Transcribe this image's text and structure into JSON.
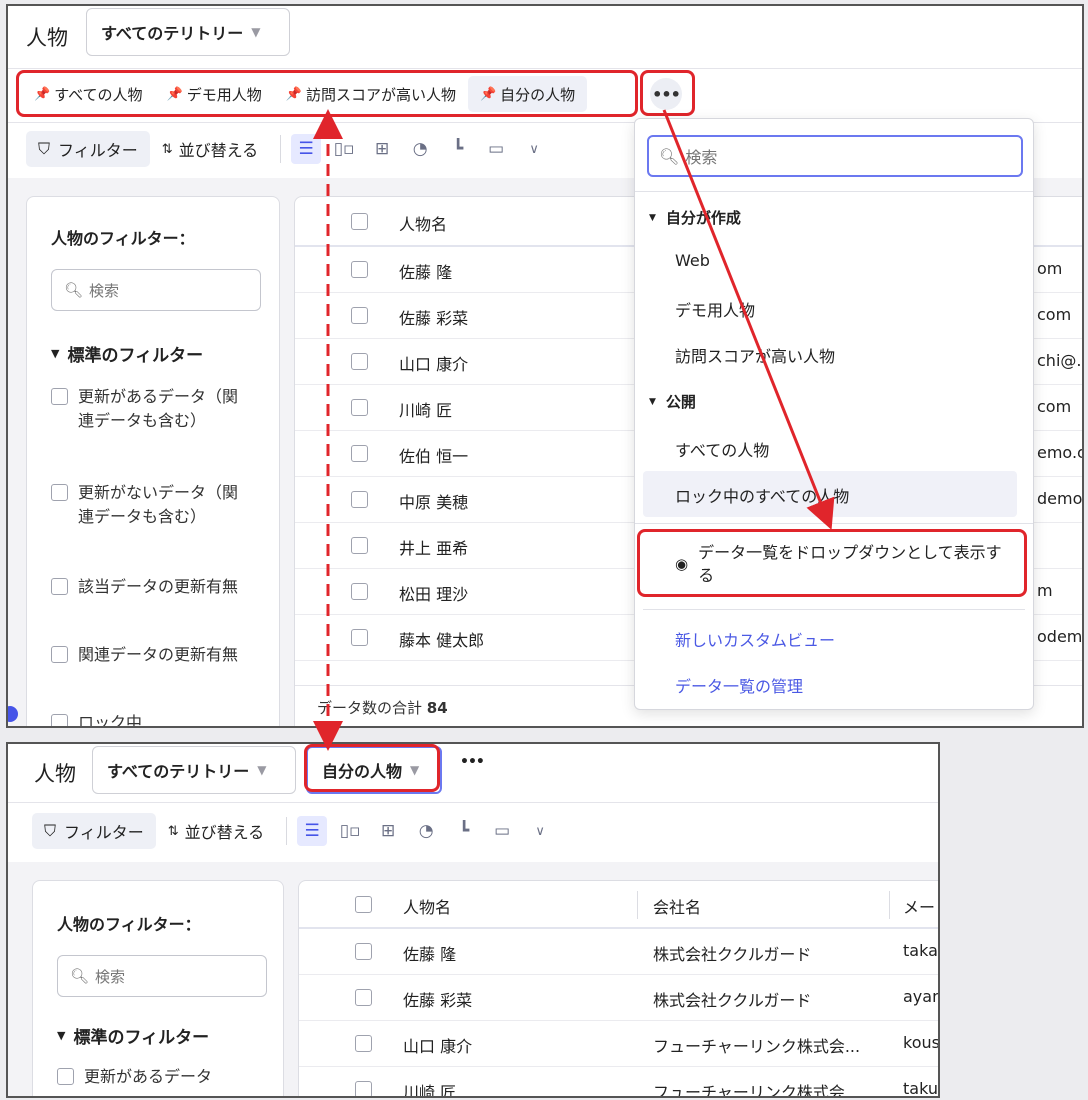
{
  "top": {
    "title": "人物",
    "territory": "すべてのテリトリー",
    "tabs": [
      {
        "label": "すべての人物"
      },
      {
        "label": "デモ用人物"
      },
      {
        "label": "訪問スコアが高い人物"
      },
      {
        "label": "自分の人物"
      }
    ],
    "more": "•••",
    "toolbar": {
      "filter": "フィルター",
      "sort": "並び替える"
    },
    "sidebar": {
      "title": "人物のフィルター：",
      "search": "検索",
      "group": "標準のフィルター",
      "items": [
        "更新があるデータ（関連データも含む）",
        "更新がないデータ（関連データも含む）",
        "該当データの更新有無",
        "関連データの更新有無",
        "ロック中"
      ]
    },
    "table": {
      "header": "人物名",
      "rows": [
        {
          "name": "佐藤 隆",
          "email": "om"
        },
        {
          "name": "佐藤 彩菜",
          "email": "com"
        },
        {
          "name": "山口 康介",
          "email": "chi@."
        },
        {
          "name": "川崎 匠",
          "email": "com"
        },
        {
          "name": "佐伯 恒一",
          "email": "emo.c"
        },
        {
          "name": "中原 美穂",
          "email": "demo."
        },
        {
          "name": "井上 亜希",
          "email": ""
        },
        {
          "name": "松田 理沙",
          "email": "m"
        },
        {
          "name": "藤本 健太郎",
          "email": "odem."
        }
      ],
      "footer_label": "データ数の合計",
      "footer_count": "84"
    },
    "dropdown": {
      "search": "検索",
      "group_mine": "自分が作成",
      "mine": [
        "Web",
        "デモ用人物",
        "訪問スコアが高い人物"
      ],
      "group_public": "公開",
      "public": [
        "すべての人物",
        "ロック中のすべての人物"
      ],
      "toggle": "データ一覧をドロップダウンとして表示する",
      "new_view": "新しいカスタムビュー",
      "manage": "データ一覧の管理"
    }
  },
  "bottom": {
    "title": "人物",
    "territory": "すべてのテリトリー",
    "view_select": "自分の人物",
    "more": "•••",
    "toolbar": {
      "filter": "フィルター",
      "sort": "並び替える"
    },
    "sidebar": {
      "title": "人物のフィルター：",
      "search": "検索",
      "group": "標準のフィルター",
      "item": "更新があるデータ"
    },
    "table": {
      "headers": [
        "人物名",
        "会社名",
        "メー"
      ],
      "rows": [
        {
          "name": "佐藤 隆",
          "company": "株式会社ククルガード",
          "email": "takas"
        },
        {
          "name": "佐藤 彩菜",
          "company": "株式会社ククルガード",
          "email": "ayana"
        },
        {
          "name": "山口 康介",
          "company": "フューチャーリンク株式会...",
          "email": "kous"
        },
        {
          "name": "川崎 匠",
          "company": "フューチャーリンク株式会...",
          "email": "takur"
        }
      ]
    }
  },
  "colors": {
    "accent": "#4b59e4",
    "annotation": "#e0252b"
  }
}
